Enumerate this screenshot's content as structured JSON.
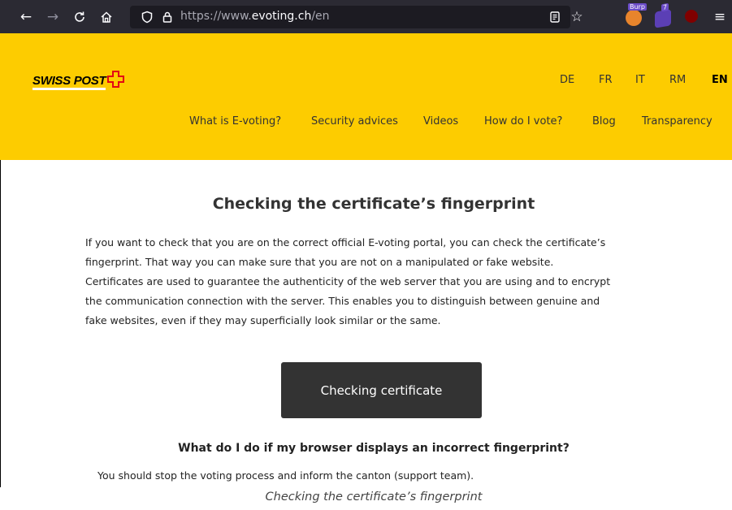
{
  "browser": {
    "url_prefix": "https://www.",
    "url_host": "evoting.ch",
    "url_suffix": "/en",
    "extensions": [
      "Burp",
      "7"
    ]
  },
  "header": {
    "logo": "SWISS POST",
    "languages": [
      "DE",
      "FR",
      "IT",
      "RM",
      "EN"
    ],
    "active_language": "EN",
    "menu": [
      "What is E-voting?",
      "Security advices",
      "Videos",
      "How do I vote?",
      "Blog",
      "Transparency"
    ]
  },
  "content": {
    "heading": "Checking the certificate’s fingerprint",
    "paragraph_lines": [
      "If you want to check that you are on the correct official E-voting portal, you can check the certificate’s",
      "fingerprint. That way you can make sure that you are not on a manipulated or fake website.",
      "Certificates are used to guarantee the authenticity of the web server that you are using and to encrypt",
      "the communication connection with the server. This enables you to distinguish between genuine and",
      "fake websites, even if they may superficially look similar or the same."
    ],
    "button_label": "Checking certificate",
    "sub_heading": "What do I do if my browser displays an incorrect fingerprint?",
    "sub_text": "You should stop the voting process and inform the canton (support team)."
  },
  "caption": "Checking the certificate’s fingerprint",
  "colors": {
    "brand_yellow": "#fdcc00",
    "button_dark": "#333333",
    "toolbar": "#2b2a33",
    "logo_red": "#e30613"
  }
}
